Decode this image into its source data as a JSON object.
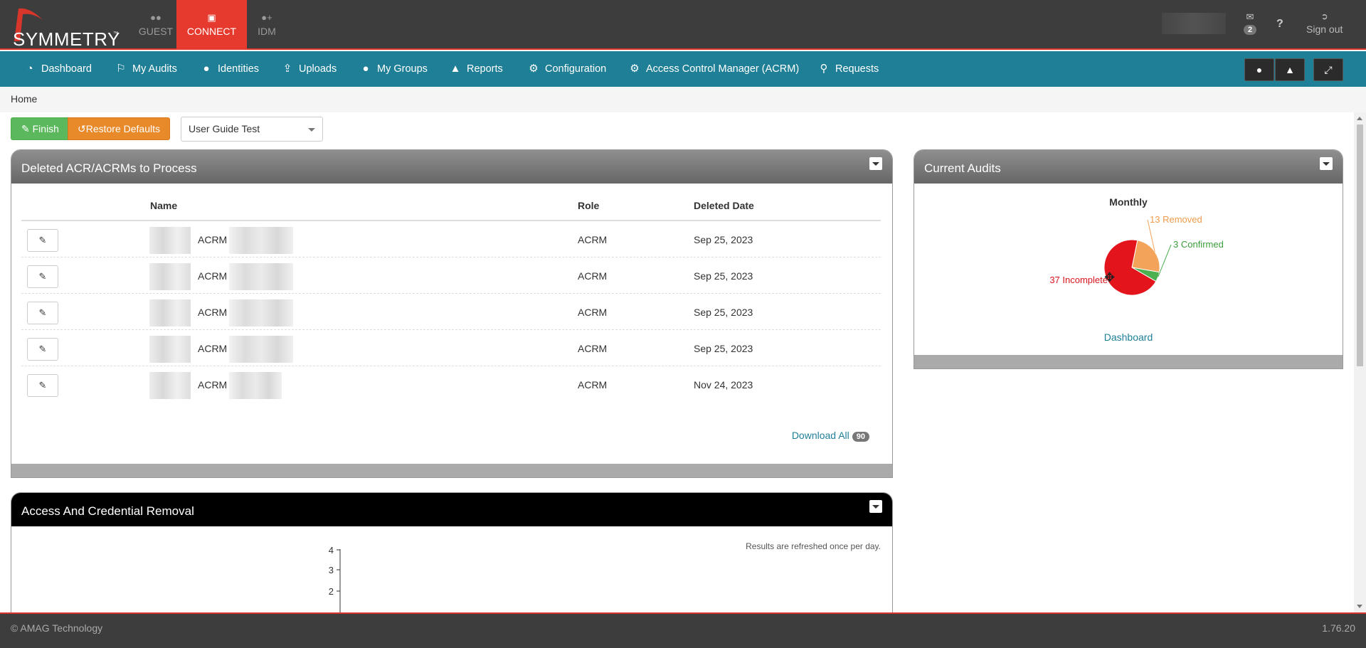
{
  "brand": {
    "logo_text": "SYMMETRY",
    "tm": "™"
  },
  "modules": [
    {
      "label": "GUEST",
      "icon": "users-icon"
    },
    {
      "label": "CONNECT",
      "icon": "card-icon",
      "active": true
    },
    {
      "label": "IDM",
      "icon": "user-plus-icon"
    }
  ],
  "topbar": {
    "messages_count": "2",
    "help": "?",
    "signout_label": "Sign out"
  },
  "nav": {
    "items": [
      {
        "label": "Dashboard",
        "icon": "dashboard-icon"
      },
      {
        "label": "My Audits",
        "icon": "flag-icon"
      },
      {
        "label": "Identities",
        "icon": "user-icon"
      },
      {
        "label": "Uploads",
        "icon": "upload-icon"
      },
      {
        "label": "My Groups",
        "icon": "users-icon"
      },
      {
        "label": "Reports",
        "icon": "area-chart-icon"
      },
      {
        "label": "Configuration",
        "icon": "gear-icon"
      },
      {
        "label": "Access Control Manager (ACRM)",
        "icon": "gear-icon"
      },
      {
        "label": "Requests",
        "icon": "key-icon"
      }
    ]
  },
  "breadcrumb": "Home",
  "toolbar": {
    "finish_label": "Finish",
    "restore_label": "Restore Defaults",
    "select_value": "User Guide Test"
  },
  "deleted_panel": {
    "title": "Deleted ACR/ACRMs to Process",
    "columns": [
      "Name",
      "Role",
      "Deleted Date"
    ],
    "rows": [
      {
        "name": "ACRM",
        "role": "ACRM",
        "date": "Sep 25, 2023"
      },
      {
        "name": "ACRM",
        "role": "ACRM",
        "date": "Sep 25, 2023"
      },
      {
        "name": "ACRM",
        "role": "ACRM",
        "date": "Sep 25, 2023"
      },
      {
        "name": "ACRM",
        "role": "ACRM",
        "date": "Sep 25, 2023"
      },
      {
        "name": "ACRM",
        "role": "ACRM",
        "date": "Nov 24, 2023"
      }
    ],
    "download_label": "Download All",
    "download_count": "90"
  },
  "audits_panel": {
    "title": "Current Audits",
    "link_label": "Dashboard"
  },
  "chart_data": {
    "type": "pie",
    "title": "Monthly",
    "slices": [
      {
        "label": "Removed",
        "value": 13,
        "color": "#f4a35a"
      },
      {
        "label": "Confirmed",
        "value": 3,
        "color": "#4caf50"
      },
      {
        "label": "Incomplete",
        "value": 37,
        "color": "#e3141c"
      }
    ],
    "data_labels": [
      "13 Removed",
      "3 Confirmed",
      "37 Incomplete"
    ]
  },
  "removal_panel": {
    "title": "Access And Credential Removal",
    "note": "Results are refreshed once per day.",
    "y_ticks": [
      "4",
      "3",
      "2"
    ]
  },
  "footer": {
    "copyright": "© AMAG Technology",
    "version": "1.76.20"
  }
}
